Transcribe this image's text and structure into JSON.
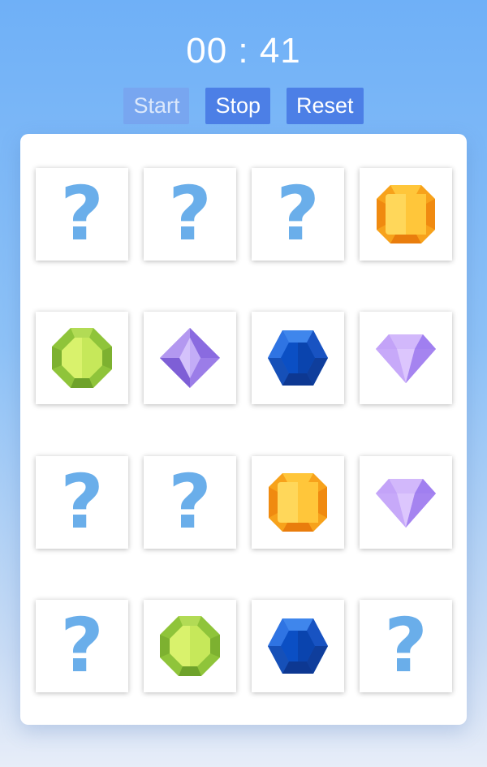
{
  "timer": {
    "minutes": "00",
    "separator": ":",
    "seconds": "41",
    "display": "00 : 41"
  },
  "controls": {
    "start": "Start",
    "stop": "Stop",
    "reset": "Reset",
    "start_disabled": true
  },
  "colors": {
    "accent": "#4c7fe6",
    "question": "#6aaeea",
    "board": "#ffffff"
  },
  "cards": [
    {
      "state": "hidden",
      "label": "?"
    },
    {
      "state": "hidden",
      "label": "?"
    },
    {
      "state": "hidden",
      "label": "?"
    },
    {
      "state": "revealed",
      "gem": "orange-gem"
    },
    {
      "state": "revealed",
      "gem": "green-gem"
    },
    {
      "state": "revealed",
      "gem": "purple-crystal-gem"
    },
    {
      "state": "revealed",
      "gem": "blue-hexagon-gem"
    },
    {
      "state": "revealed",
      "gem": "purple-diamond-gem"
    },
    {
      "state": "hidden",
      "label": "?"
    },
    {
      "state": "hidden",
      "label": "?"
    },
    {
      "state": "revealed",
      "gem": "orange-gem"
    },
    {
      "state": "revealed",
      "gem": "purple-diamond-gem"
    },
    {
      "state": "hidden",
      "label": "?"
    },
    {
      "state": "revealed",
      "gem": "green-gem"
    },
    {
      "state": "revealed",
      "gem": "blue-hexagon-gem"
    },
    {
      "state": "hidden",
      "label": "?"
    }
  ]
}
